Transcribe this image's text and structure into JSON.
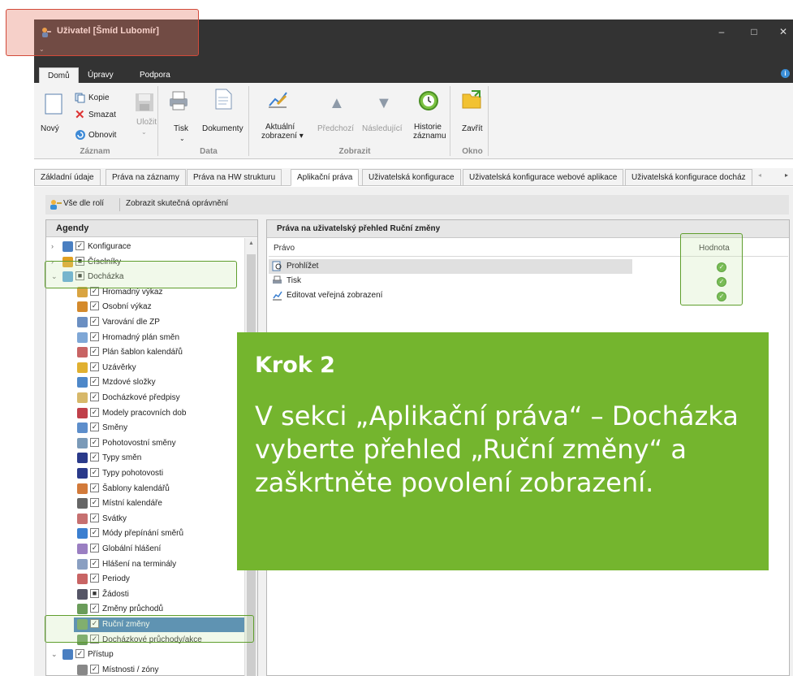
{
  "window": {
    "title": "Uživatel [Šmíd Lubomír]",
    "quick_access": "⌄",
    "controls": [
      "–",
      "□",
      "✕"
    ]
  },
  "ribbon_tabs": [
    {
      "label": "Domů",
      "active": true
    },
    {
      "label": "Úpravy",
      "active": false
    },
    {
      "label": "Podpora",
      "active": false
    }
  ],
  "ribbon": {
    "groups": {
      "zaznam": "Záznam",
      "data": "Data",
      "zobrazit": "Zobrazit",
      "okno": "Okno"
    },
    "buttons": {
      "novy": "Nový",
      "kopie": "Kopie",
      "smazat": "Smazat",
      "obnovit": "Obnovit",
      "ulozit": "Uložit",
      "tisk": "Tisk",
      "dokumenty": "Dokumenty",
      "aktualni_1": "Aktuální",
      "aktualni_2": "zobrazení ▾",
      "predchozi": "Předchozí",
      "nasledujici": "Následující",
      "historie_1": "Historie",
      "historie_2": "záznamu",
      "zavrit": "Zavřít"
    }
  },
  "page_tabs": [
    {
      "label": "Základní údaje"
    },
    {
      "label": "Práva na záznamy"
    },
    {
      "label": "Práva na HW strukturu"
    },
    {
      "label": "Aplikační práva",
      "active": true
    },
    {
      "label": "Uživatelská konfigurace"
    },
    {
      "label": "Uživatelská konfigurace webové aplikace"
    },
    {
      "label": "Uživatelská konfigurace docház"
    }
  ],
  "toolbar": {
    "vse_dle_roli": "Vše dle rolí",
    "zobrazit_opravneni": "Zobrazit skutečná oprávnění"
  },
  "left_panel": {
    "header": "Agendy",
    "tree": [
      {
        "label": "Konfigurace",
        "level": 0,
        "arrow": "›",
        "check": "✓",
        "icon_color": "#4a7fc1"
      },
      {
        "label": "Číselníky",
        "level": 0,
        "arrow": "›",
        "check": "■",
        "icon_color": "#e0a020"
      },
      {
        "label": "Docházka",
        "level": 0,
        "arrow": "⌄",
        "check": "■",
        "icon_color": "#5ba4d8"
      },
      {
        "label": "Hromadný výkaz",
        "level": 1,
        "check": "✓",
        "icon_color": "#d9a441"
      },
      {
        "label": "Osobní výkaz",
        "level": 1,
        "check": "✓",
        "icon_color": "#d48a2c"
      },
      {
        "label": "Varování dle ZP",
        "level": 1,
        "check": "✓",
        "icon_color": "#6b8fc2"
      },
      {
        "label": "Hromadný plán směn",
        "level": 1,
        "check": "✓",
        "icon_color": "#7fa7d6"
      },
      {
        "label": "Plán šablon kalendářů",
        "level": 1,
        "check": "✓",
        "icon_color": "#c86464"
      },
      {
        "label": "Uzávěrky",
        "level": 1,
        "check": "✓",
        "icon_color": "#e0b030"
      },
      {
        "label": "Mzdové složky",
        "level": 1,
        "check": "✓",
        "icon_color": "#4e88c9"
      },
      {
        "label": "Docházkové předpisy",
        "level": 1,
        "check": "✓",
        "icon_color": "#d7b86a"
      },
      {
        "label": "Modely pracovních dob",
        "level": 1,
        "check": "✓",
        "icon_color": "#c0404a"
      },
      {
        "label": "Směny",
        "level": 1,
        "check": "✓",
        "icon_color": "#5d8ecb"
      },
      {
        "label": "Pohotovostní směny",
        "level": 1,
        "check": "✓",
        "icon_color": "#7a9ab8"
      },
      {
        "label": "Typy směn",
        "level": 1,
        "check": "✓",
        "icon_color": "#2a3a8a"
      },
      {
        "label": "Typy pohotovosti",
        "level": 1,
        "check": "✓",
        "icon_color": "#2a3a8a"
      },
      {
        "label": "Šablony kalendářů",
        "level": 1,
        "check": "✓",
        "icon_color": "#d27a3a"
      },
      {
        "label": "Místní kalendáře",
        "level": 1,
        "check": "✓",
        "icon_color": "#666"
      },
      {
        "label": "Svátky",
        "level": 1,
        "check": "✓",
        "icon_color": "#c67070"
      },
      {
        "label": "Módy přepínání směrů",
        "level": 1,
        "check": "✓",
        "icon_color": "#3b7fd0"
      },
      {
        "label": "Globální hlášení",
        "level": 1,
        "check": "✓",
        "icon_color": "#9a7fc2"
      },
      {
        "label": "Hlášení na terminály",
        "level": 1,
        "check": "✓",
        "icon_color": "#8a9fc2"
      },
      {
        "label": "Periody",
        "level": 1,
        "check": "✓",
        "icon_color": "#c86464"
      },
      {
        "label": "Žádosti",
        "level": 1,
        "check": "■",
        "icon_color": "#556"
      },
      {
        "label": "Změny průchodů",
        "level": 1,
        "check": "✓",
        "icon_color": "#6a9c5a"
      },
      {
        "label": "Ruční změny",
        "level": 1,
        "check": "✓",
        "icon_color": "#6a9c5a",
        "selected": true
      },
      {
        "label": "Docházkové průchody/akce",
        "level": 1,
        "check": "✓",
        "icon_color": "#6a9c5a"
      },
      {
        "label": "Přístup",
        "level": 0,
        "arrow": "⌄",
        "check": "✓",
        "icon_color": "#4a7fc1"
      },
      {
        "label": "Místnosti / zóny",
        "level": 1,
        "check": "✓",
        "icon_color": "#888"
      }
    ]
  },
  "right_panel": {
    "header": "Práva na uživatelský přehled Ruční změny",
    "col_pravo": "Právo",
    "col_hodnota": "Hodnota",
    "rows": [
      {
        "label": "Prohlížet",
        "value": "✓",
        "selected": true
      },
      {
        "label": "Tisk",
        "value": "✓"
      },
      {
        "label": "Editovat veřejná zobrazení",
        "value": "✓"
      }
    ]
  },
  "callout": {
    "head": "Krok 2",
    "body": "V sekci  „Aplikační práva“ – Docházka vyberte přehled „Ruční změny“ a zaškrtněte povolení zobrazení."
  }
}
